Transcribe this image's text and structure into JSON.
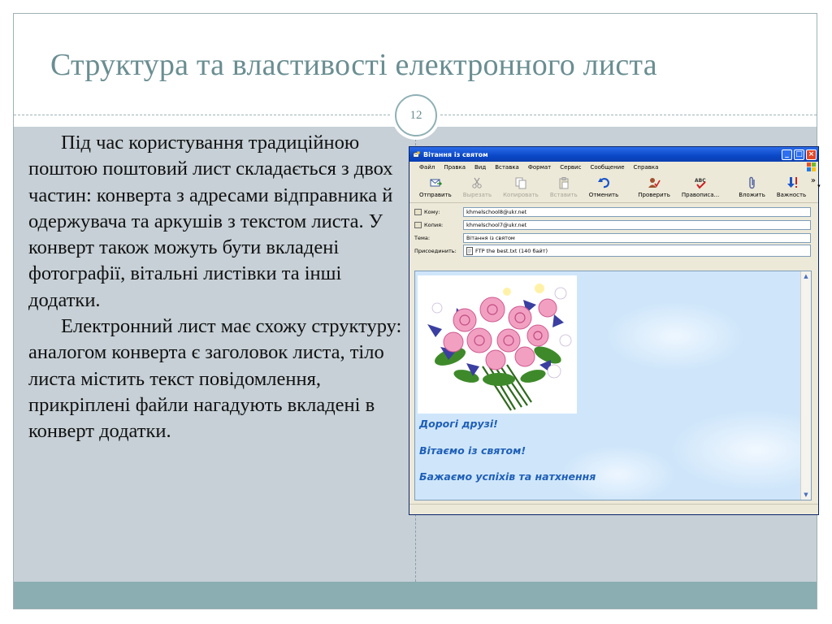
{
  "slide": {
    "title": "Структура та властивості електронного листа",
    "number": "12",
    "paragraphs": [
      "Під час користування традиційною поштою поштовий лист складається з двох частин: конверта з адресами відправника й одержувача та аркушів з текстом листа. У конверт також можуть бути вкладені фотографії, вітальні листівки та інші додатки.",
      "Електронний лист має схожу структуру: аналогом конверта є заголовок листа, тіло листа містить текст повідомлення, прикріплені файли нагадують вкладені в конверт додатки."
    ]
  },
  "window": {
    "title": "Вітання із  святом",
    "menu": [
      "Файл",
      "Правка",
      "Вид",
      "Вставка",
      "Формат",
      "Сервис",
      "Сообщение",
      "Справка"
    ],
    "toolbar": {
      "send": "Отправить",
      "cut": "Вырезать",
      "copy": "Копировать",
      "paste": "Вставить",
      "undo": "Отменить",
      "check": "Проверить",
      "spell": "Правописа...",
      "attach": "Вложить",
      "priority": "Важность"
    },
    "fields": {
      "to_label": "Кому:",
      "to_value": "khmelschool8@ukr.net",
      "cc_label": "Копия:",
      "cc_value": "khmelschool7@ukr.net",
      "subject_label": "Тема:",
      "subject_value": "Вітання із  святом",
      "attach_label": "Присоединить:",
      "attach_value": "FTP the best.txt (140 байт)"
    },
    "message": {
      "line1": "Дорогі друзі!",
      "line2": "Вітаємо із святом!",
      "line3": "Бажаємо успіхів та натхнення"
    }
  },
  "colors": {
    "title": "#6a8e92",
    "body_bg": "#c6d0d6",
    "band": "#8aaeb1",
    "message_text": "#1f5fb8"
  }
}
